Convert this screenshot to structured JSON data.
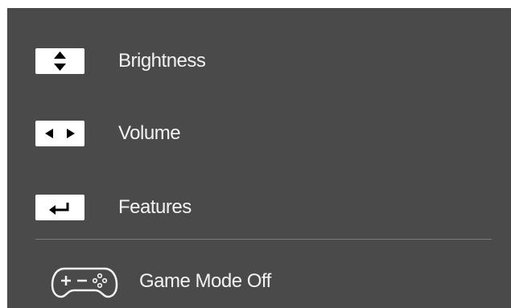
{
  "menu": {
    "items": [
      {
        "label": "Brightness",
        "key_icon": "up-down-arrows-icon"
      },
      {
        "label": "Volume",
        "key_icon": "left-right-arrows-icon"
      },
      {
        "label": "Features",
        "key_icon": "enter-return-icon"
      }
    ],
    "game_mode": {
      "label": "Game Mode Off",
      "icon": "gamepad-icon"
    }
  },
  "colors": {
    "panel_background": "#4a4a4a",
    "text": "#f2f2f2",
    "keycap": "#ffffff",
    "divider": "#7a7a7a"
  }
}
